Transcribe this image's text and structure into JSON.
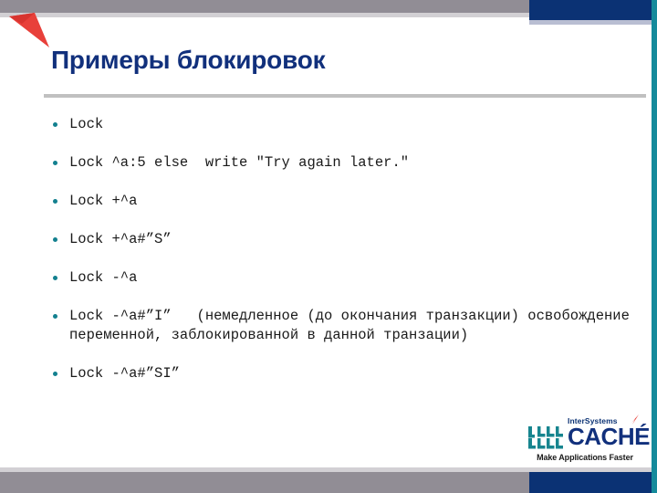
{
  "slide": {
    "title": "Примеры блокировок",
    "bullets": [
      {
        "text": "Lock"
      },
      {
        "text": "Lock ^a:5 else  write \"Try again later.\""
      },
      {
        "text": "Lock +^a"
      },
      {
        "text": "Lock +^a#”S”"
      },
      {
        "text": "Lock -^a"
      },
      {
        "text": "Lock -^a#”I”   (немедленное (до окончания транзакции) освобождение переменной, заблокированной в данной транзации)"
      },
      {
        "text": "Lock -^a#”SI”"
      }
    ]
  },
  "logo": {
    "brand": "InterSystems",
    "product": "CACHÉ",
    "tagline": "Make Applications Faster"
  },
  "colors": {
    "title_blue": "#11307c",
    "bar_gray": "#918d95",
    "bar_blue": "#0b3274",
    "teal": "#158a9b",
    "bullet_teal": "#13808f",
    "accent_red": "#e8403a",
    "rule_gray": "#c0c0c0"
  }
}
